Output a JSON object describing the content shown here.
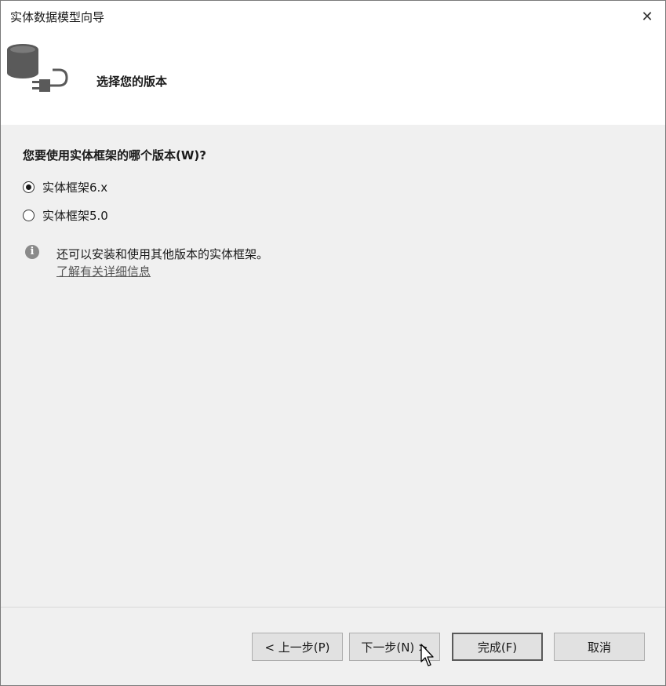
{
  "window": {
    "title": "实体数据模型向导",
    "close_glyph": "✕"
  },
  "header": {
    "title": "选择您的版本",
    "icon": "database-plug-icon"
  },
  "main": {
    "question": "您要使用实体框架的哪个版本(W)?",
    "options": [
      {
        "label": "实体框架6.x",
        "selected": true
      },
      {
        "label": "实体框架5.0",
        "selected": false
      }
    ],
    "info": {
      "icon_glyph": "i",
      "text": "还可以安装和使用其他版本的实体框架。",
      "link": "了解有关详细信息"
    }
  },
  "footer": {
    "back_label": "< 上一步(P)",
    "next_label": "下一步(N) >",
    "finish_label": "完成(F)",
    "cancel_label": "取消"
  },
  "colors": {
    "body_bg": "#f0f0f0",
    "header_bg": "#ffffff",
    "button_bg": "#e1e1e1",
    "icon_gray": "#5a5a5a"
  }
}
